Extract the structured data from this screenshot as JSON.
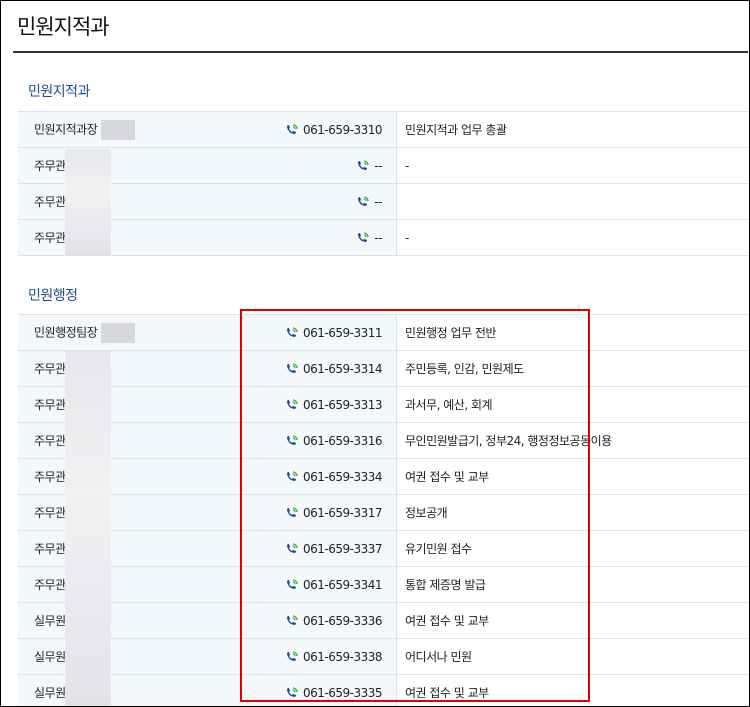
{
  "page": {
    "title": "민원지적과"
  },
  "sections": [
    {
      "heading": "민원지적과",
      "rows": [
        {
          "name": "민원지적과장",
          "phone": "061-659-3310",
          "duty": "민원지적과 업무 총괄"
        },
        {
          "name": "주무관",
          "phone": "--",
          "duty": "-"
        },
        {
          "name": "주무관",
          "phone": "--",
          "duty": ""
        },
        {
          "name": "주무관",
          "phone": "--",
          "duty": "-"
        }
      ]
    },
    {
      "heading": "민원행정",
      "rows": [
        {
          "name": "민원행정팀장",
          "phone": "061-659-3311",
          "duty": "민원행정 업무 전반"
        },
        {
          "name": "주무관",
          "phone": "061-659-3314",
          "duty": "주민등록, 인감, 민원제도"
        },
        {
          "name": "주무관",
          "phone": "061-659-3313",
          "duty": "과서무, 예산, 회계"
        },
        {
          "name": "주무관",
          "phone": "061-659-3316",
          "duty": "무인민원발급기, 정부24, 행정정보공동이용"
        },
        {
          "name": "주무관",
          "phone": "061-659-3334",
          "duty": "여권 접수 및 교부"
        },
        {
          "name": "주무관",
          "phone": "061-659-3317",
          "duty": "정보공개"
        },
        {
          "name": "주무관",
          "phone": "061-659-3337",
          "duty": "유기민원 접수"
        },
        {
          "name": "주무관",
          "phone": "061-659-3341",
          "duty": "통합 제증명 발급"
        },
        {
          "name": "실무원",
          "phone": "061-659-3336",
          "duty": "여권 접수 및 교부"
        },
        {
          "name": "실무원",
          "phone": "061-659-3338",
          "duty": "어디서나 민원"
        },
        {
          "name": "실무원",
          "phone": "061-659-3335",
          "duty": "여권 접수 및 교부"
        }
      ]
    }
  ],
  "icons": {
    "phone": "phone-icon"
  },
  "colors": {
    "heading": "#1f4e8c",
    "highlight": "#e00000",
    "icon_green": "#2fae3c",
    "icon_blue": "#1f4e8c"
  }
}
